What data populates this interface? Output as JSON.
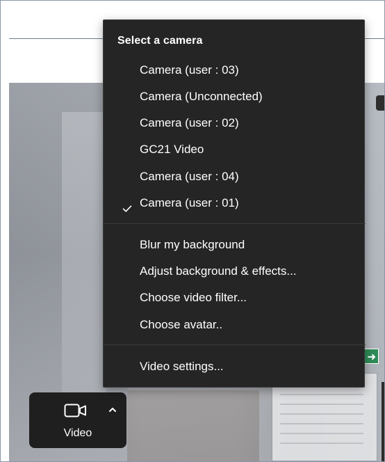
{
  "menu": {
    "title": "Select a camera",
    "cameras": [
      {
        "label": "Camera (user : 03)",
        "selected": false
      },
      {
        "label": "Camera (Unconnected)",
        "selected": false
      },
      {
        "label": "Camera (user : 02)",
        "selected": false
      },
      {
        "label": "GC21 Video",
        "selected": false
      },
      {
        "label": "Camera (user : 04)",
        "selected": false
      },
      {
        "label": "Camera (user : 01)",
        "selected": true
      }
    ],
    "background_options": [
      {
        "label": "Blur my background"
      },
      {
        "label": "Adjust background & effects..."
      },
      {
        "label": "Choose video filter..."
      },
      {
        "label": "Choose avatar.."
      }
    ],
    "settings": {
      "label": "Video settings..."
    }
  },
  "video_control": {
    "label": "Video"
  },
  "icons": {
    "checkmark": "check-icon",
    "video": "video-camera-icon",
    "caret": "chevron-up-icon"
  },
  "colors": {
    "menu_bg": "#252525",
    "menu_text": "#ffffff",
    "control_bg": "#1f1f1f",
    "separator": "#3b3b3b"
  }
}
